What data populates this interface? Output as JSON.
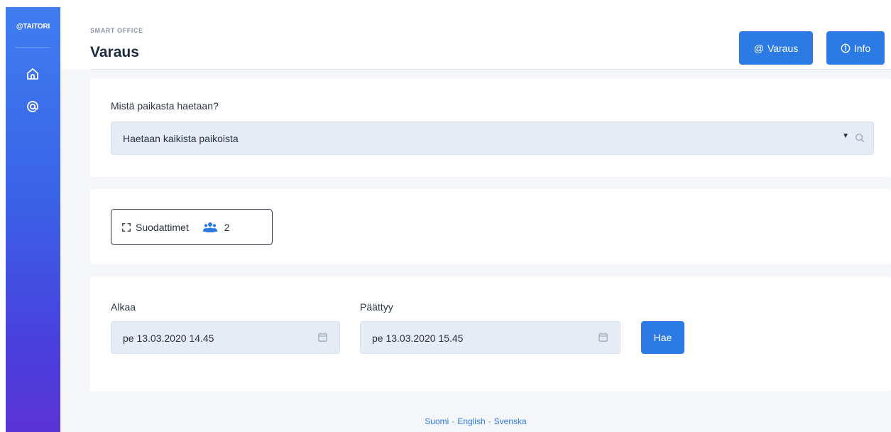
{
  "brand": {
    "name": "@TAITORI"
  },
  "sidebar": {
    "items": [
      {
        "icon": "home-icon"
      },
      {
        "icon": "at-icon"
      }
    ]
  },
  "header": {
    "eyebrow": "SMART OFFICE",
    "title": "Varaus",
    "buttons": {
      "varaus_icon": "@",
      "varaus_label": "Varaus",
      "info_label": "Info"
    }
  },
  "location": {
    "label": "Mistä paikasta haetaan?",
    "selected": "Haetaan kaikista paikoista",
    "caret": "▼"
  },
  "filters": {
    "label": "Suodattimet",
    "people_count": "2"
  },
  "dates": {
    "start_label": "Alkaa",
    "start_value": "pe 13.03.2020 14.45",
    "end_label": "Päättyy",
    "end_value": "pe 13.03.2020 15.45",
    "search_label": "Hae"
  },
  "footer": {
    "languages": [
      "Suomi",
      "English",
      "Svenska"
    ],
    "separator": "-"
  },
  "colors": {
    "primary": "#2c7be5",
    "input_bg": "#e6ecf5",
    "page_bg": "#f4f6fa",
    "sidebar_top": "#3f7df0",
    "sidebar_bottom": "#5a33d6"
  }
}
